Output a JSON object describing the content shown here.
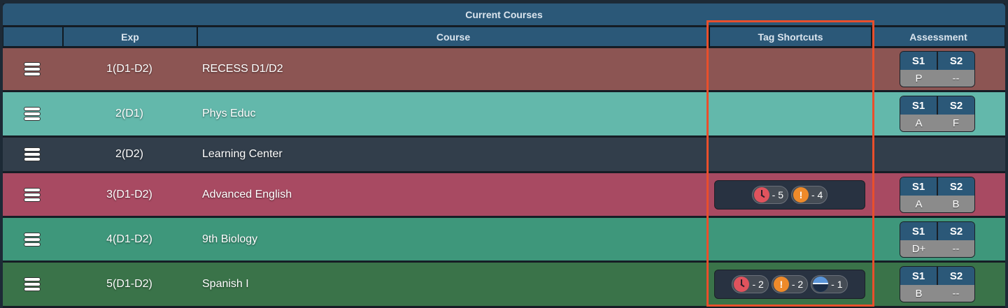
{
  "title": "Current Courses",
  "headers": {
    "menu": "",
    "exp": "Exp",
    "course": "Course",
    "tags": "Tag Shortcuts",
    "assessment": "Assessment"
  },
  "colors": {
    "header": "#2b5878",
    "highlight": "#e94f2c"
  },
  "rows": [
    {
      "exp": "1(D1-D2)",
      "course": "RECESS D1/D2",
      "color": "#8c5553",
      "tags": [],
      "assessment": {
        "s1_label": "S1",
        "s2_label": "S2",
        "s1": "P",
        "s2": "--"
      }
    },
    {
      "exp": "2(D1)",
      "course": "Phys Educ",
      "color": "#63b8ab",
      "tags": [],
      "assessment": {
        "s1_label": "S1",
        "s2_label": "S2",
        "s1": "A",
        "s2": "F"
      }
    },
    {
      "exp": "2(D2)",
      "course": "Learning Center",
      "color": "#323e4b",
      "tags": [],
      "assessment": null
    },
    {
      "exp": "3(D1-D2)",
      "course": "Advanced English",
      "color": "#a84a62",
      "tags": [
        {
          "icon": "clock-icon",
          "label": "- 5"
        },
        {
          "icon": "exclamation-icon",
          "label": "- 4"
        }
      ],
      "assessment": {
        "s1_label": "S1",
        "s2_label": "S2",
        "s1": "A",
        "s2": "B"
      }
    },
    {
      "exp": "4(D1-D2)",
      "course": "9th Biology",
      "color": "#3e977b",
      "tags": [],
      "assessment": {
        "s1_label": "S1",
        "s2_label": "S2",
        "s1": "D+",
        "s2": "--"
      }
    },
    {
      "exp": "5(D1-D2)",
      "course": "Spanish I",
      "color": "#3a7349",
      "tags": [
        {
          "icon": "clock-icon",
          "label": "- 2"
        },
        {
          "icon": "exclamation-icon",
          "label": "- 2"
        },
        {
          "icon": "half-circle-icon",
          "label": "- 1"
        }
      ],
      "assessment": {
        "s1_label": "S1",
        "s2_label": "S2",
        "s1": "B",
        "s2": "--"
      }
    }
  ]
}
